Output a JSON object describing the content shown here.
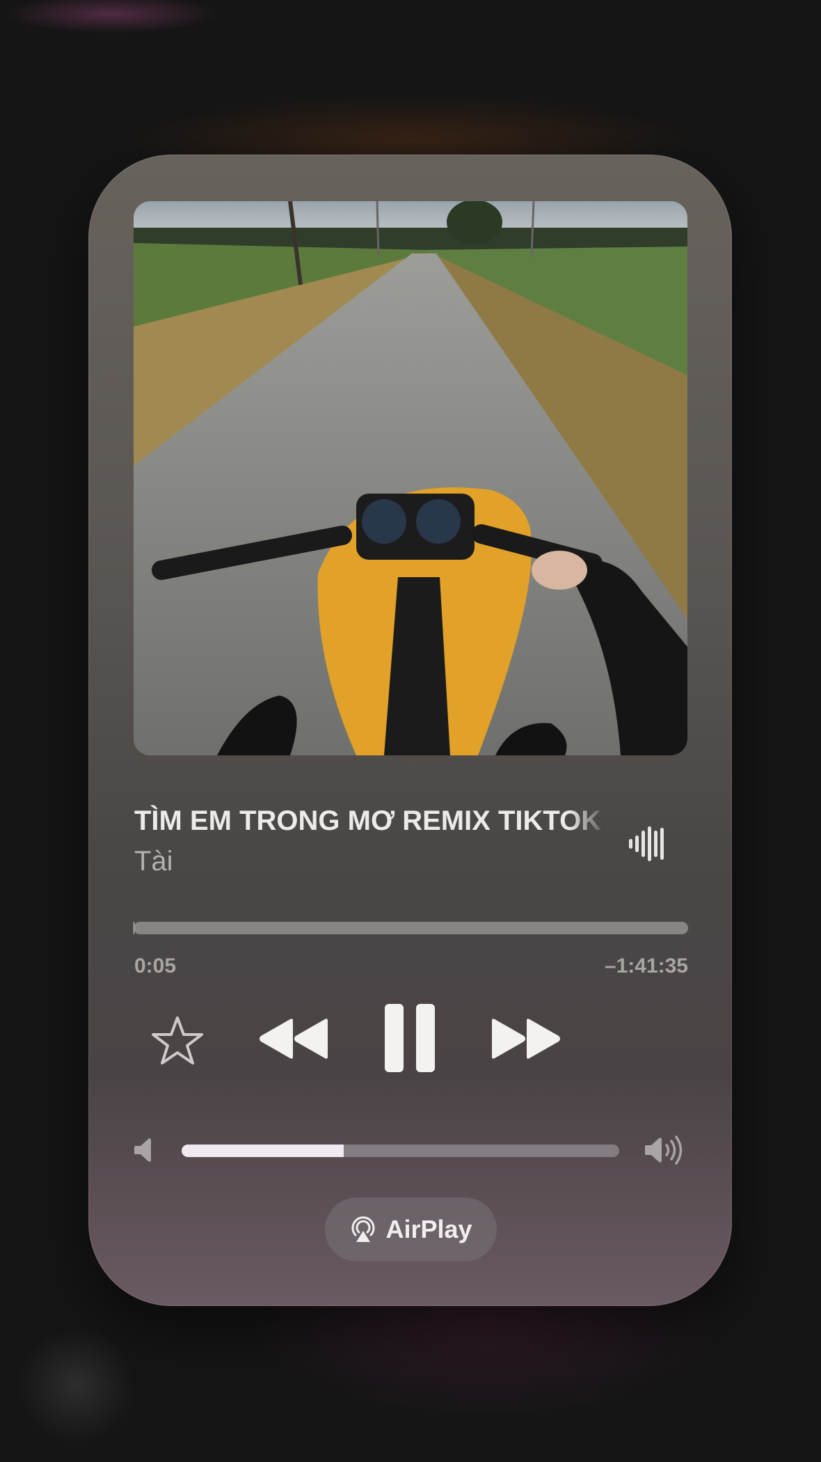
{
  "now_playing": {
    "title": "TÌM EM TRONG MƠ REMIX TIKTOK",
    "artist": "Tài",
    "artwork_icon": "album-artwork",
    "waveform_icon": "waveform-icon"
  },
  "playback": {
    "elapsed": "0:05",
    "remaining": "–1:41:35",
    "progress_fraction": 0.0008
  },
  "controls": {
    "favorite_icon": "star-icon",
    "previous_icon": "rewind-icon",
    "play_pause_icon": "pause-icon",
    "next_icon": "fast-forward-icon"
  },
  "volume": {
    "level_fraction": 0.37,
    "low_icon": "speaker-low-icon",
    "high_icon": "speaker-high-icon"
  },
  "airplay": {
    "label": "AirPlay",
    "icon": "airplay-icon"
  },
  "colors": {
    "card_top": "#67625c",
    "card_bottom": "#6a5a62",
    "text_primary": "#ecebea",
    "text_secondary": "#b4b0ad",
    "volume_fill": "#f0e9f1"
  }
}
